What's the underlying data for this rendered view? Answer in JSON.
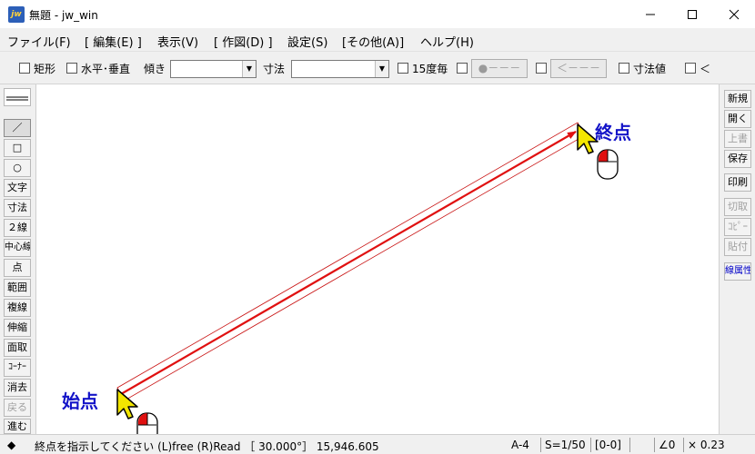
{
  "window": {
    "title": "無題 - jw_win",
    "app_icon_text": "jw"
  },
  "menu": [
    "ファイル(F)",
    "[ 編集(E) ]",
    "表示(V)",
    "[ 作図(D) ]",
    "設定(S)",
    "[その他(A)]",
    "ヘルプ(H)"
  ],
  "toolbar": {
    "rect": "矩形",
    "hv": "水平･垂直",
    "tilt": "傾き",
    "tilt_value": "",
    "dim": "寸法",
    "dim_value": "",
    "deg15": "15度毎",
    "btn1": "●－－－",
    "btn2": "＜－－－",
    "dimval": "寸法値",
    "lt": "＜"
  },
  "left_tools": [
    "／",
    "□",
    "○",
    "文字",
    "寸法",
    "２線",
    "中心線",
    "点",
    "範囲",
    "複線",
    "伸縮",
    "面取",
    "ｺｰﾅｰ",
    "消去",
    "戻る",
    "進む"
  ],
  "right_tools": [
    "新規",
    "開く",
    "上書",
    "保存",
    "印刷",
    "切取",
    "ｺﾋﾟｰ",
    "貼付",
    "線属性"
  ],
  "canvas": {
    "start_label": "始点",
    "end_label": "終点"
  },
  "status": {
    "diamond": "◆",
    "message": "終点を指示してください (L)free (R)Read ［ 30.000°］ 15,946.605",
    "paper": "A-4",
    "scale": "S=1/50",
    "layer": "[0-0]",
    "angle": "∠0",
    "zoom": "× 0.23"
  },
  "colors": {
    "line": "#e01010",
    "label": "#1414c8",
    "cursor": "#f3e600"
  }
}
